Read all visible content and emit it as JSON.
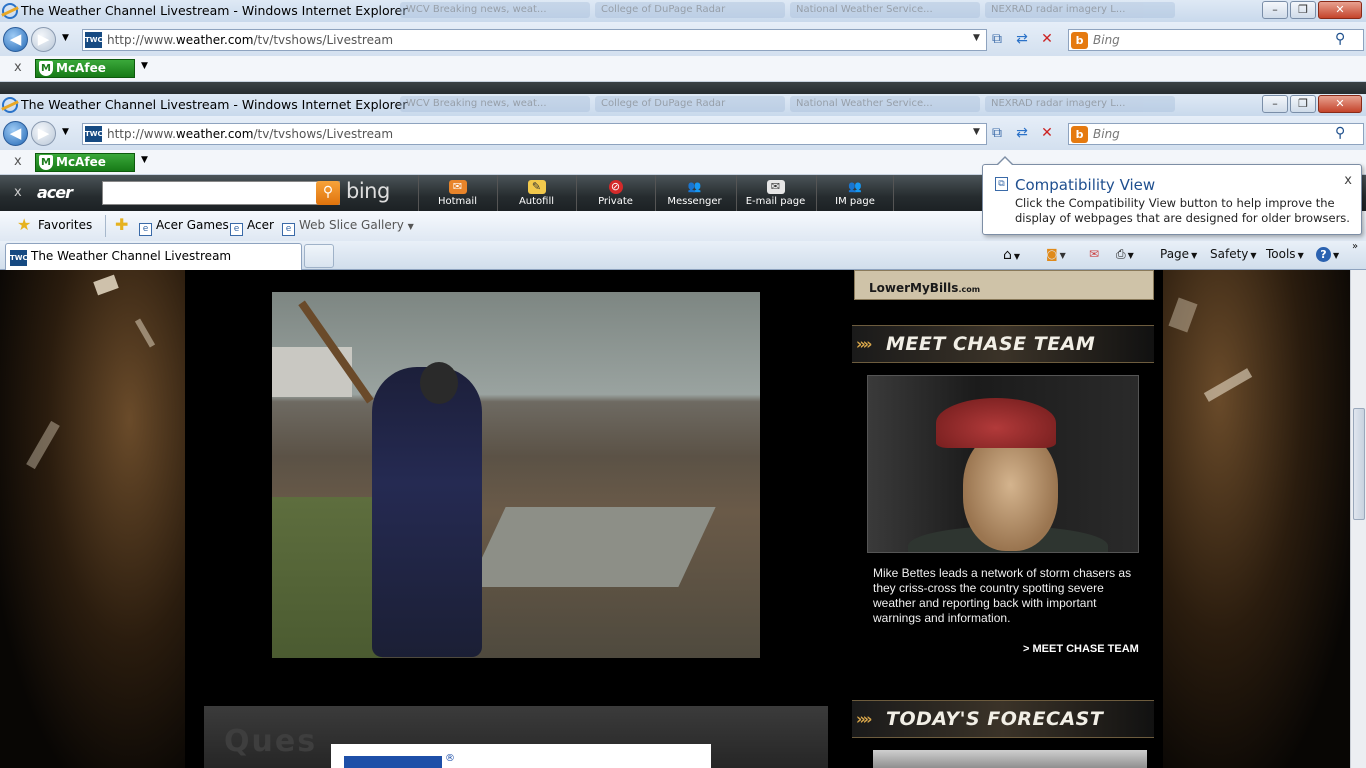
{
  "window": {
    "title": "The Weather Channel Livestream - Windows Internet Explorer",
    "ghost_tabs": [
      "WCV Breaking news, weat...",
      "College of DuPage Radar",
      "National Weather Service...",
      "NEXRAD radar imagery L..."
    ],
    "minimize": "–",
    "restore": "❐",
    "close": "✕"
  },
  "address_bar": {
    "site_icon": "TWC",
    "url_prefix": "http://www.",
    "url_domain": "weather.com",
    "url_path": "/tv/tvshows/Livestream",
    "search_placeholder": "Bing",
    "compat_icon": "compatibility-view-icon",
    "refresh_icon": "refresh-icon",
    "stop_icon": "stop-icon"
  },
  "mcafee": {
    "close": "x",
    "label": "McAfee",
    "dropdown": "▼"
  },
  "acer_toolbar": {
    "close": "x",
    "logo": "acer",
    "search_brand": "bing",
    "buttons": [
      {
        "label": "Hotmail",
        "icon": "hotmail-icon",
        "color": "#e8842a"
      },
      {
        "label": "Autofill",
        "icon": "autofill-icon",
        "color": "#f2c94c"
      },
      {
        "label": "Private",
        "icon": "private-icon",
        "color": "#d42a2a"
      },
      {
        "label": "Messenger",
        "icon": "messenger-icon",
        "color": "#5fb84a"
      },
      {
        "label": "E-mail page",
        "icon": "email-icon",
        "color": "#e6e6e6"
      },
      {
        "label": "IM page",
        "icon": "im-icon",
        "color": "#5fb84a"
      }
    ]
  },
  "favorites_bar": {
    "favorites": "Favorites",
    "items": [
      "Acer Games",
      "Acer",
      "Web Slice Gallery"
    ]
  },
  "tabs": {
    "active": "The Weather Channel Livestream"
  },
  "command_bar": {
    "page": "Page",
    "safety": "Safety",
    "tools": "Tools",
    "help": "?"
  },
  "compat_tooltip": {
    "title": "Compatibility View",
    "body": "Click the Compatibility View button to help improve the display of webpages that are designed for older browsers.",
    "close": "x"
  },
  "page": {
    "ad_top": {
      "brand": "LowerMyBills",
      "tld": ".com"
    },
    "chase_header": "MEET CHASE TEAM",
    "chase_text": "Mike Bettes leads a network of storm chasers as they criss-cross the country spotting severe weather and reporting back with important warnings and information.",
    "chase_link": "> MEET CHASE TEAM",
    "forecast_header": "TODAY'S FORECAST"
  }
}
